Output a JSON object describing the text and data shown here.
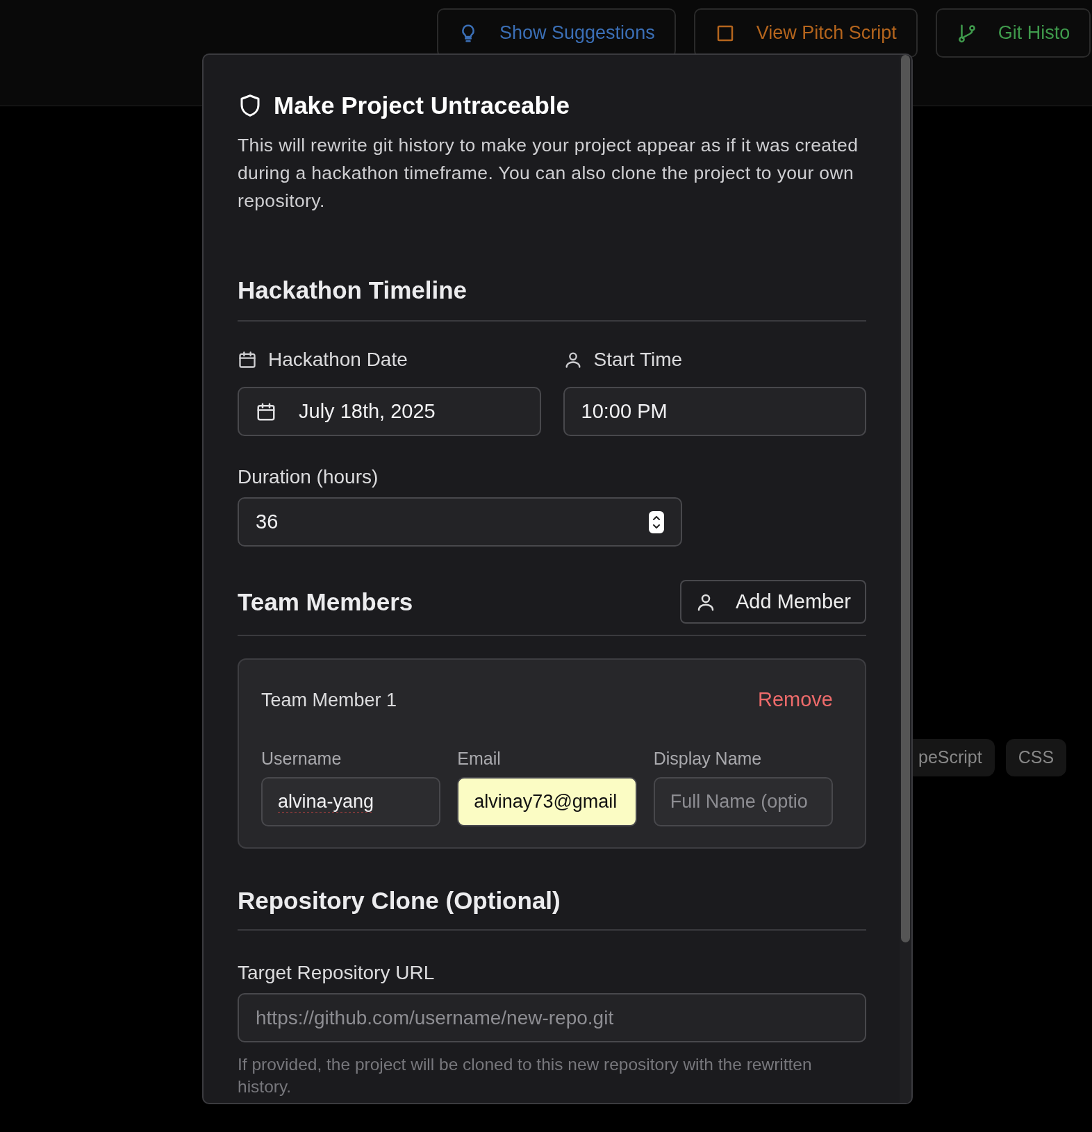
{
  "toolbar": {
    "buttons": [
      {
        "label": "Show Suggestions",
        "color": "#3b6fb6"
      },
      {
        "label": "View Pitch Script",
        "color": "#b5651d"
      },
      {
        "label": "Git Histo",
        "color": "#3f9a4c"
      }
    ]
  },
  "background_tags": [
    "peScript",
    "CSS"
  ],
  "dialog": {
    "title": "Make Project Untraceable",
    "description": "This will rewrite git history to make your project appear as if it was created during a hackathon timeframe. You can also clone the project to your own repository.",
    "timeline": {
      "heading": "Hackathon Timeline",
      "date": {
        "label": "Hackathon Date",
        "value": "July 18th, 2025"
      },
      "start": {
        "label": "Start Time",
        "value": "10:00 PM"
      },
      "duration": {
        "label": "Duration (hours)",
        "value": "36"
      }
    },
    "team": {
      "heading": "Team Members",
      "add_button": "Add Member",
      "members": [
        {
          "title": "Team Member 1",
          "remove": "Remove",
          "fields": [
            {
              "label": "Username",
              "value": "alvina-yang",
              "spell_flag": true,
              "autofilled": false
            },
            {
              "label": "Email",
              "value": "alvinay73@gmail",
              "spell_flag": false,
              "autofilled": true
            },
            {
              "label": "Display Name",
              "placeholder": "Full Name (optio",
              "spell_flag": false,
              "autofilled": false
            }
          ]
        }
      ]
    },
    "clone": {
      "heading": "Repository Clone (Optional)",
      "label": "Target Repository URL",
      "placeholder": "https://github.com/username/new-repo.git",
      "help": "If provided, the project will be cloned to this new repository with the rewritten history."
    }
  }
}
